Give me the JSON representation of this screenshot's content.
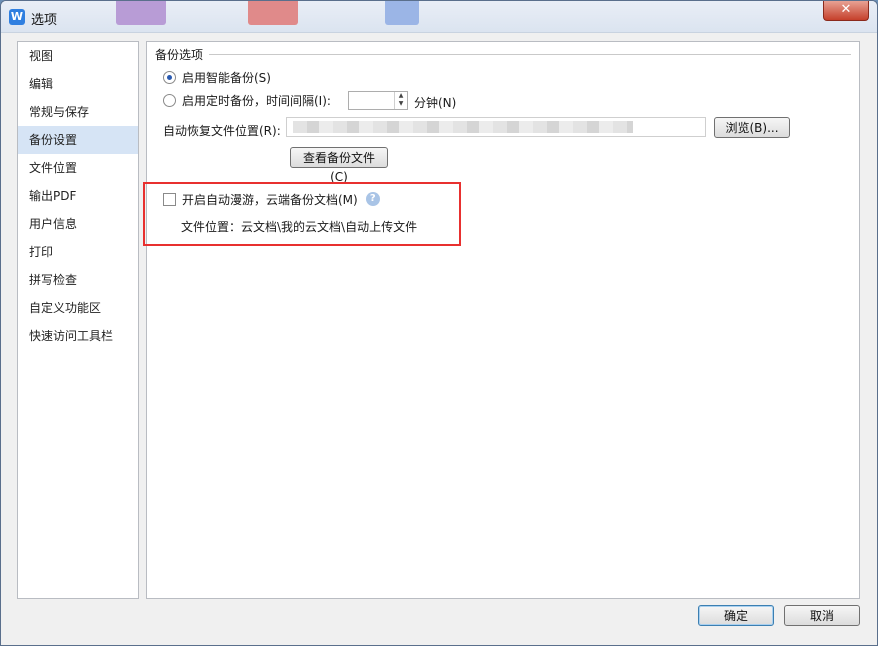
{
  "window": {
    "title": "选项",
    "app_icon_glyph": "W",
    "close_glyph": "✕"
  },
  "sidebar": {
    "items": [
      {
        "label": "视图"
      },
      {
        "label": "编辑"
      },
      {
        "label": "常规与保存"
      },
      {
        "label": "备份设置",
        "active": true
      },
      {
        "label": "文件位置"
      },
      {
        "label": "输出PDF"
      },
      {
        "label": "用户信息"
      },
      {
        "label": "打印"
      },
      {
        "label": "拼写检查"
      },
      {
        "label": "自定义功能区"
      },
      {
        "label": "快速访问工具栏"
      }
    ]
  },
  "backup": {
    "group_title": "备份选项",
    "smart_backup_label": "启用智能备份(S)",
    "timed_backup_label": "启用定时备份，时间间隔(I):",
    "interval_value": "",
    "minutes_label": "分钟(N)",
    "recover_path_label": "自动恢复文件位置(R):",
    "browse_label": "浏览(B)...",
    "view_backup_label": "查看备份文件(C)",
    "selected": "smart"
  },
  "cloud": {
    "roaming_label": "开启自动漫游，云端备份文档(M)",
    "roaming_checked": false,
    "help_glyph": "?",
    "location_text": "文件位置：云文档\\我的云文档\\自动上传文件"
  },
  "footer": {
    "ok_label": "确定",
    "cancel_label": "取消"
  },
  "colors": {
    "highlight_border": "#e8302f",
    "active_item_bg": "#d6e4f5",
    "close_button": "#c5402b"
  }
}
